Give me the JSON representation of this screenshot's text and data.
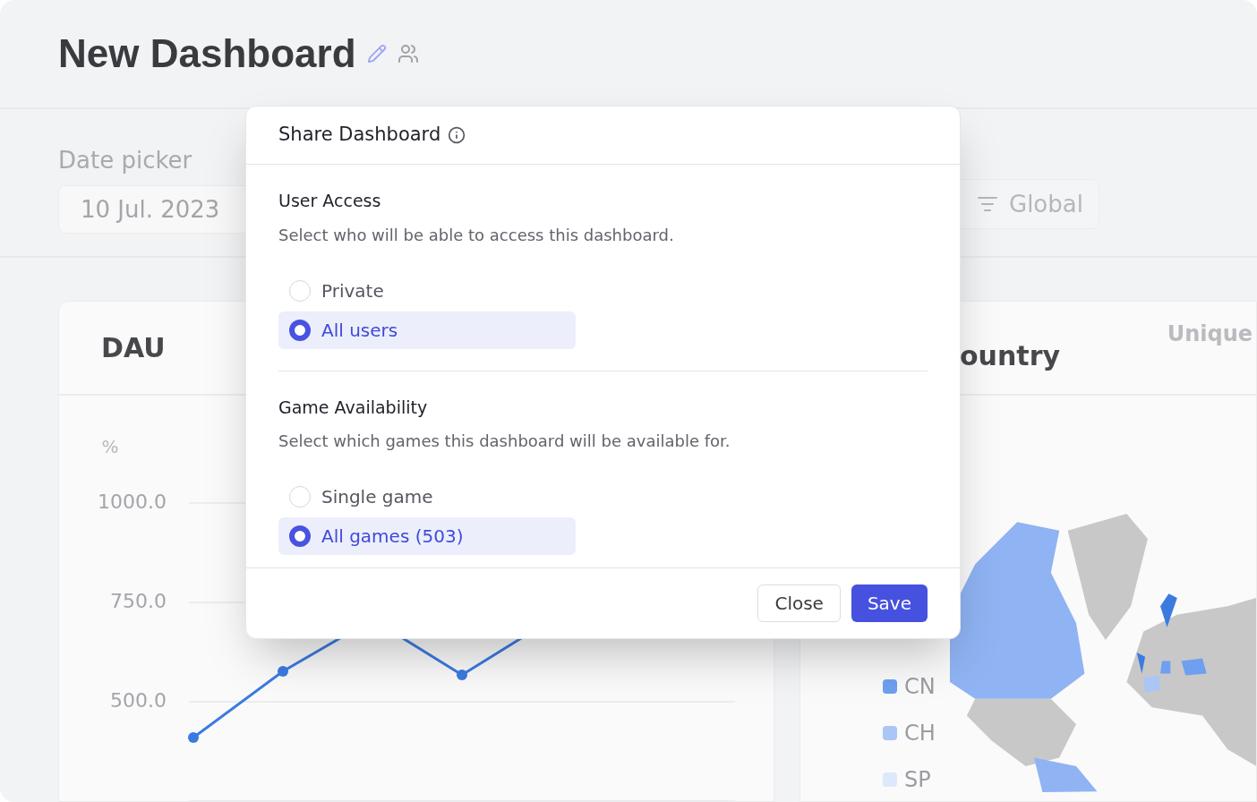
{
  "page": {
    "title": "New Dashboard",
    "filters": {
      "date_label": "Date picker",
      "date_value": "10 Jul. 2023",
      "global_button": "Global"
    },
    "cards": [
      {
        "kind": "chart",
        "title": "DAU",
        "axis_label": "%",
        "tick_labels": [
          "1000.0",
          "750.0",
          "500.0"
        ]
      },
      {
        "kind": "map",
        "title": "ountry",
        "metric": "Unique",
        "legend": [
          {
            "label": "CN",
            "color": "#6f9ff0"
          },
          {
            "label": "CH",
            "color": "#a9c6f5"
          },
          {
            "label": "SP",
            "color": "#dde8fb"
          }
        ]
      }
    ]
  },
  "dialog": {
    "title": "Share Dashboard",
    "sections": [
      {
        "title": "User Access",
        "description": "Select who will be able to access this dashboard.",
        "options": [
          {
            "label": "Private",
            "selected": false
          },
          {
            "label": "All users",
            "selected": true
          }
        ]
      },
      {
        "title": "Game Availability",
        "description": "Select which games this dashboard will be available for.",
        "options": [
          {
            "label": "Single game",
            "selected": false
          },
          {
            "label": "All games (503)",
            "selected": true
          }
        ]
      }
    ],
    "buttons": [
      {
        "label": "Close",
        "kind": "secondary"
      },
      {
        "label": "Save",
        "kind": "primary"
      }
    ]
  }
}
